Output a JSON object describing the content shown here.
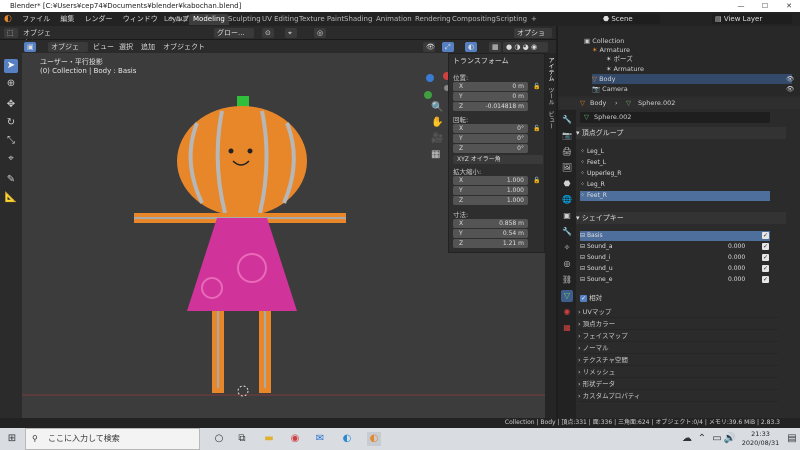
{
  "window": {
    "title": "Blender* [C:¥Users¥cep74¥Documents¥blender¥kabochan.blend]"
  },
  "menu": {
    "items": [
      "ファイル",
      "編集",
      "レンダー",
      "ウィンドウ",
      "ヘルプ"
    ]
  },
  "workspaces": [
    "Layout",
    "Modeling",
    "Sculpting",
    "UV Editing",
    "Texture Paint",
    "Shading",
    "Animation",
    "Rendering",
    "Compositing",
    "Scripting"
  ],
  "active_workspace": "Modeling",
  "scene": {
    "label": "Scene",
    "view_layer": "View Layer"
  },
  "viewport": {
    "mode": "オブジェクト...",
    "menus": [
      "ビュー",
      "選択",
      "追加",
      "オブジェクト"
    ],
    "transform_orientation": "グロー...",
    "options_label": "オプション",
    "view_name": "ユーザー・平行投影",
    "collection_info": "(0) Collection | Body : Basis"
  },
  "n_panel": {
    "title": "トランスフォーム",
    "location_label": "位置:",
    "location": [
      {
        "axis": "X",
        "value": "0 m"
      },
      {
        "axis": "Y",
        "value": "0 m"
      },
      {
        "axis": "Z",
        "value": "-0.014818 m"
      }
    ],
    "rotation_label": "回転:",
    "rotation": [
      {
        "axis": "X",
        "value": "0°"
      },
      {
        "axis": "Y",
        "value": "0°"
      },
      {
        "axis": "Z",
        "value": "0°"
      }
    ],
    "rotation_mode": "XYZ オイラー角",
    "scale_label": "拡大縮小:",
    "scale": [
      {
        "axis": "X",
        "value": "1.000"
      },
      {
        "axis": "Y",
        "value": "1.000"
      },
      {
        "axis": "Z",
        "value": "1.000"
      }
    ],
    "dimensions_label": "寸法:",
    "dimensions": [
      {
        "axis": "X",
        "value": "0.858 m"
      },
      {
        "axis": "Y",
        "value": "0.54 m"
      },
      {
        "axis": "Z",
        "value": "1.21 m"
      }
    ],
    "tabs": [
      "アイテム",
      "ツール",
      "ビュー"
    ]
  },
  "outliner": {
    "items": [
      "Collection",
      "Armature",
      "ポーズ",
      "Armature",
      "Body",
      "Camera"
    ]
  },
  "properties": {
    "object_name": "Body",
    "mesh_name": "Sphere.002",
    "mesh_field": "Sphere.002",
    "vertex_groups_title": "頂点グループ",
    "vertex_groups": [
      "Leg_L",
      "Feet_L",
      "Upperleg_R",
      "Leg_R",
      "Feet_R"
    ],
    "shape_keys_title": "シェイプキー",
    "shape_keys": [
      {
        "name": "Basis",
        "value": ""
      },
      {
        "name": "Sound_a",
        "value": "0.000"
      },
      {
        "name": "Sound_i",
        "value": "0.000"
      },
      {
        "name": "Sound_u",
        "value": "0.000"
      },
      {
        "name": "Soune_e",
        "value": "0.000"
      }
    ],
    "relative_label": "相対",
    "panels": [
      "UVマップ",
      "頂点カラー",
      "フェイスマップ",
      "ノーマル",
      "テクスチャ空間",
      "リメッシュ",
      "形状データ",
      "カスタムプロパティ"
    ]
  },
  "statusbar": {
    "text": "Collection | Body | 頂点:331 | 面:336 | 三角面:624 | オブジェクト:0/4 | メモリ:39.6 MiB | 2.83.3"
  },
  "taskbar": {
    "search_placeholder": "ここに入力して検索",
    "time": "21:33",
    "date": "2020/08/31"
  },
  "colors": {
    "accent": "#5680c2",
    "pumpkin": "#e8862a",
    "dress": "#d0339a",
    "stem": "#2fbf3a"
  }
}
